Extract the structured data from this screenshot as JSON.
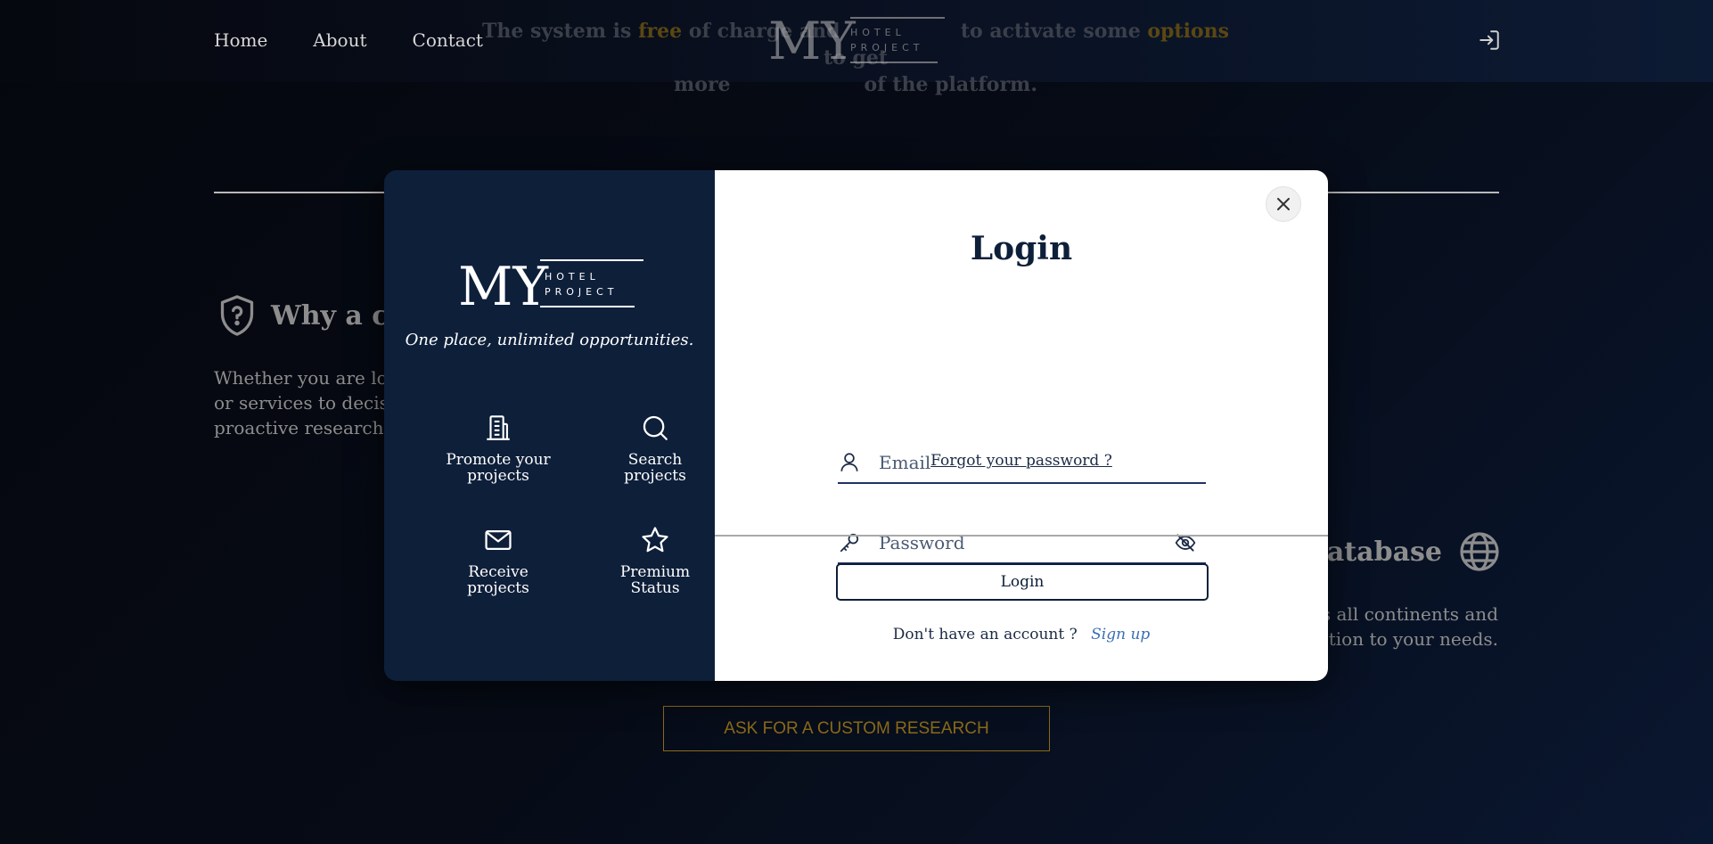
{
  "nav": {
    "home": "Home",
    "about": "About",
    "contact": "Contact"
  },
  "hero": {
    "part1": "The system is ",
    "free": "free",
    "part2": " of charge and ",
    "part3": " to activate some ",
    "options": "options",
    "part4": " to get",
    "line2a": "more",
    "line2b": "of the platform."
  },
  "brand": {
    "my": "MY",
    "hotel": "HOTEL",
    "project": "PROJECT"
  },
  "sections": {
    "why_title": "Why a cu",
    "why_text_1": "Whether you are loo",
    "why_text_2": "or services to decisi",
    "why_text_3": "proactive research b",
    "db_title": "database",
    "db_text_1": "s all continents and",
    "db_text_2": "ution to your needs."
  },
  "cta": {
    "label": "ASK FOR A CUSTOM RESEARCH"
  },
  "modal": {
    "tagline": "One place, unlimited opportunities.",
    "features": [
      {
        "line1": "Promote your",
        "line2": "projects"
      },
      {
        "line1": "Search",
        "line2": "projects"
      },
      {
        "line1": "Receive",
        "line2": "projects"
      },
      {
        "line1": "Premium",
        "line2": "Status"
      }
    ],
    "title": "Login",
    "email_placeholder": "Email",
    "password_placeholder": "Password",
    "forgot": "Forgot your password ?",
    "login_button": "Login",
    "no_account": "Don't have an account ?",
    "signup": "Sign up"
  },
  "colors": {
    "navy": "#0e1f3a",
    "gold": "#8a6a18",
    "link_blue": "#3d6fb4"
  }
}
